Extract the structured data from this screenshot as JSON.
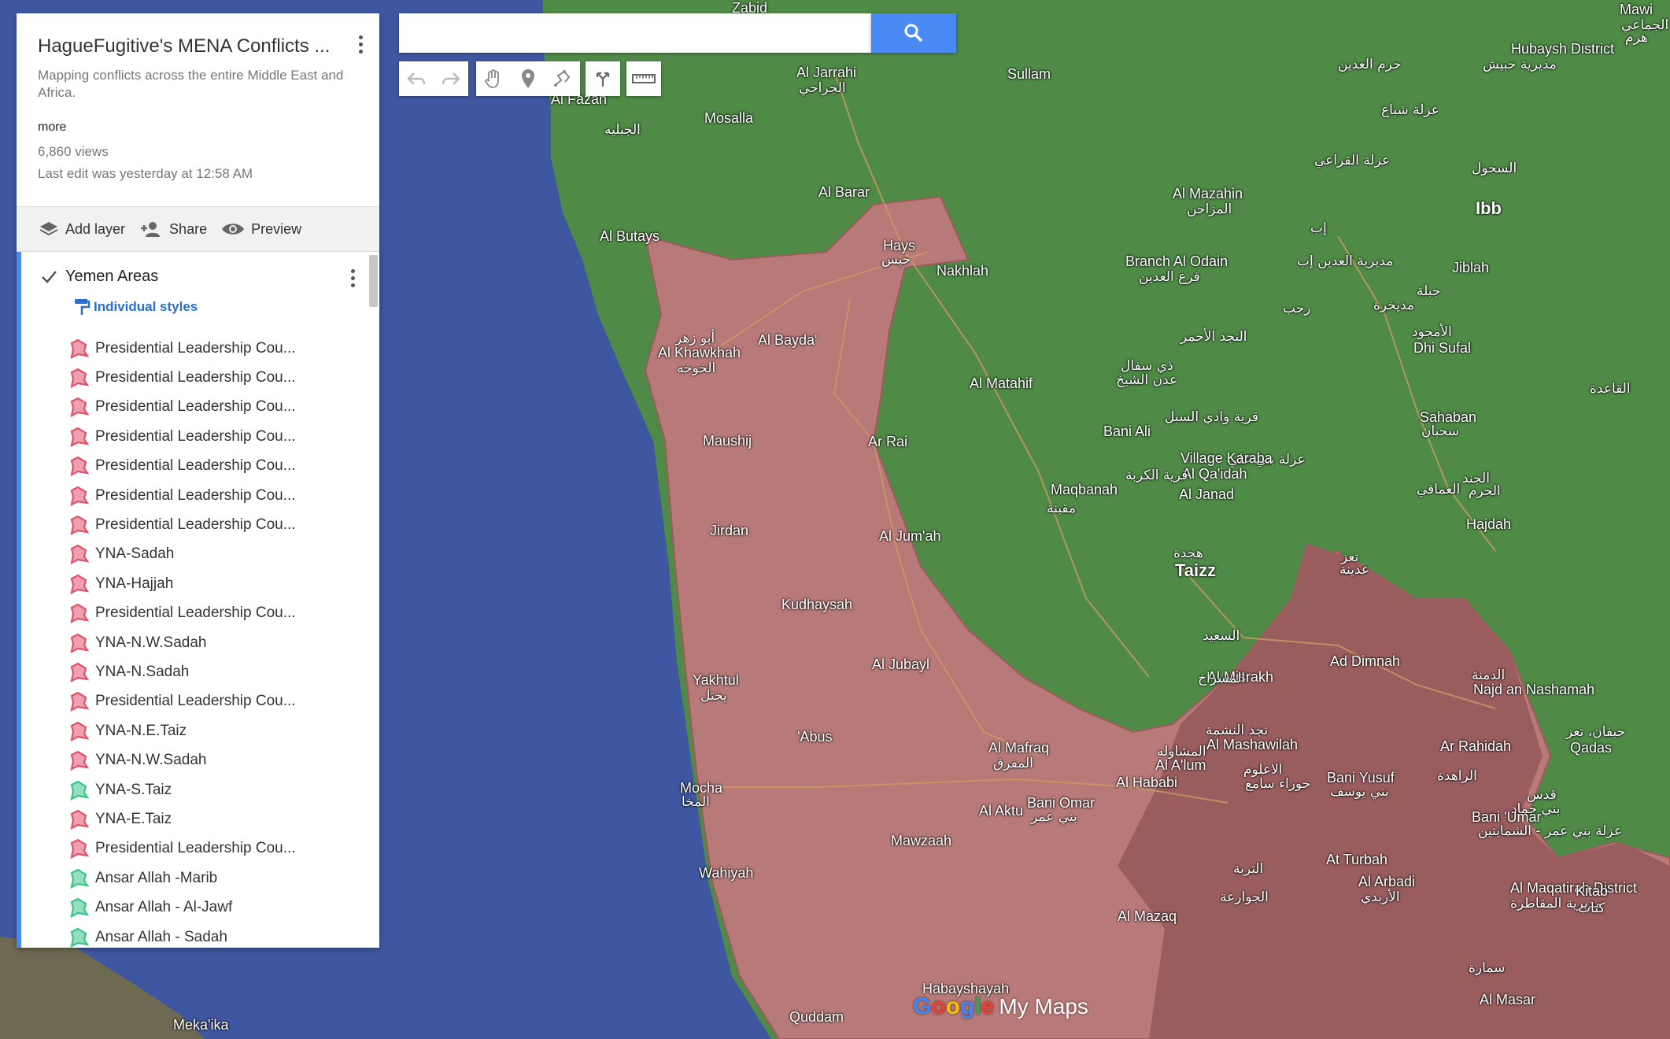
{
  "map": {
    "colors": {
      "sea": "#3f57a0",
      "land": "#4f8a47",
      "red_zone": "#b87a78",
      "dark_red_zone": "#9a5d5e",
      "panel_accent": "#4a8af4"
    },
    "labels": [
      {
        "text": "Zabid",
        "kind": "place"
      },
      {
        "text": "Al Jarrahi",
        "kind": "place"
      },
      {
        "text": "الجراحي",
        "kind": "ar"
      },
      {
        "text": "Al Fazah",
        "kind": "place"
      },
      {
        "text": "Mosalla",
        "kind": "place"
      },
      {
        "text": "الجبليه",
        "kind": "ar"
      },
      {
        "text": "Sullam",
        "kind": "place"
      },
      {
        "text": "Al Barar",
        "kind": "place"
      },
      {
        "text": "Al Butays",
        "kind": "place"
      },
      {
        "text": "Hays",
        "kind": "place"
      },
      {
        "text": "حيس",
        "kind": "ar"
      },
      {
        "text": "Nakhlah",
        "kind": "place"
      },
      {
        "text": "أبو زهر",
        "kind": "ar"
      },
      {
        "text": "Al Khawkhah",
        "kind": "place"
      },
      {
        "text": "الخوخه",
        "kind": "ar"
      },
      {
        "text": "Al Bayda'",
        "kind": "place"
      },
      {
        "text": "Al Matahif",
        "kind": "place"
      },
      {
        "text": "Maushij",
        "kind": "place"
      },
      {
        "text": "Ar Rai",
        "kind": "place"
      },
      {
        "text": "Jirdan",
        "kind": "place"
      },
      {
        "text": "Al Jum'ah",
        "kind": "place"
      },
      {
        "text": "Kudhaysah",
        "kind": "place"
      },
      {
        "text": "Al Jubayl",
        "kind": "place"
      },
      {
        "text": "Yakhtul",
        "kind": "place"
      },
      {
        "text": "يختل",
        "kind": "ar"
      },
      {
        "text": "'Abus",
        "kind": "place"
      },
      {
        "text": "Mocha",
        "kind": "place"
      },
      {
        "text": "المخا",
        "kind": "ar"
      },
      {
        "text": "Al Mafraq",
        "kind": "place"
      },
      {
        "text": "المفرق",
        "kind": "ar"
      },
      {
        "text": "Al Aktu",
        "kind": "place"
      },
      {
        "text": "Bani Omar",
        "kind": "place"
      },
      {
        "text": "بني عمر",
        "kind": "ar"
      },
      {
        "text": "Al Hababi",
        "kind": "place"
      },
      {
        "text": "Mawzaah",
        "kind": "place"
      },
      {
        "text": "Wahiyah",
        "kind": "place"
      },
      {
        "text": "Al Mazaq",
        "kind": "place"
      },
      {
        "text": "Habayshayah",
        "kind": "place"
      },
      {
        "text": "Quddam",
        "kind": "place"
      },
      {
        "text": "Meka'ika",
        "kind": "place"
      },
      {
        "text": "Hubaysh District",
        "kind": "place"
      },
      {
        "text": "مديرية حبيش",
        "kind": "ar"
      },
      {
        "text": "حرم العدين",
        "kind": "ar"
      },
      {
        "text": "عزلة شباع",
        "kind": "ar"
      },
      {
        "text": "عزلة القراعي",
        "kind": "ar"
      },
      {
        "text": "السحول",
        "kind": "ar"
      },
      {
        "text": "Al Mazahin",
        "kind": "place"
      },
      {
        "text": "المزاحن",
        "kind": "ar"
      },
      {
        "text": "Ibb",
        "kind": "city"
      },
      {
        "text": "إب",
        "kind": "ar"
      },
      {
        "text": "مديرية العدين إب",
        "kind": "ar"
      },
      {
        "text": "Branch Al Odain",
        "kind": "place"
      },
      {
        "text": "فرع العدين",
        "kind": "ar"
      },
      {
        "text": "Jiblah",
        "kind": "place"
      },
      {
        "text": "جبلة",
        "kind": "ar"
      },
      {
        "text": "رحب",
        "kind": "ar"
      },
      {
        "text": "مذيخرة",
        "kind": "ar"
      },
      {
        "text": "النجد الأحمر",
        "kind": "ar"
      },
      {
        "text": "الأمجود",
        "kind": "ar"
      },
      {
        "text": "Dhi Sufal",
        "kind": "place"
      },
      {
        "text": "ذي سفال",
        "kind": "ar"
      },
      {
        "text": "عدن الشيخ",
        "kind": "ar"
      },
      {
        "text": "قرية وادي السبل",
        "kind": "ar"
      },
      {
        "text": "Bani Ali",
        "kind": "place"
      },
      {
        "text": "عزلة بني علي",
        "kind": "ar"
      },
      {
        "text": "Al Qa'idah",
        "kind": "place"
      },
      {
        "text": "القاعدة",
        "kind": "ar"
      },
      {
        "text": "Sahaban",
        "kind": "place"
      },
      {
        "text": "سحبان",
        "kind": "ar"
      },
      {
        "text": "Village Karaba",
        "kind": "place"
      },
      {
        "text": "قرية الكربة",
        "kind": "ar"
      },
      {
        "text": "العماقي",
        "kind": "ar"
      },
      {
        "text": "Maqbanah",
        "kind": "place"
      },
      {
        "text": "مقبنة",
        "kind": "ar"
      },
      {
        "text": "Al Janad",
        "kind": "place"
      },
      {
        "text": "الجند",
        "kind": "ar"
      },
      {
        "text": "الجرم",
        "kind": "ar"
      },
      {
        "text": "Hajdah",
        "kind": "place"
      },
      {
        "text": "هجدة",
        "kind": "ar"
      },
      {
        "text": "Taizz",
        "kind": "city"
      },
      {
        "text": "تعز",
        "kind": "ar"
      },
      {
        "text": "عدينة",
        "kind": "ar"
      },
      {
        "text": "السعيد",
        "kind": "ar"
      },
      {
        "text": "Al Misrakh",
        "kind": "place"
      },
      {
        "text": "المسراخ",
        "kind": "ar"
      },
      {
        "text": "Ad Dimnah",
        "kind": "place"
      },
      {
        "text": "الدمنة",
        "kind": "ar"
      },
      {
        "text": "Najd an Nashamah",
        "kind": "place"
      },
      {
        "text": "نجد النشمة",
        "kind": "ar"
      },
      {
        "text": "Al Mashawilah",
        "kind": "place"
      },
      {
        "text": "المشاوله",
        "kind": "ar"
      },
      {
        "text": "Al A'lum",
        "kind": "place"
      },
      {
        "text": "الاعلوم",
        "kind": "ar"
      },
      {
        "text": "خوراء سامع",
        "kind": "ar"
      },
      {
        "text": "Bani Yusuf",
        "kind": "place"
      },
      {
        "text": "بني يوسف",
        "kind": "ar"
      },
      {
        "text": "Ar Rahidah",
        "kind": "place"
      },
      {
        "text": "الراهدة",
        "kind": "ar"
      },
      {
        "text": "حيفان، تعز",
        "kind": "ar"
      },
      {
        "text": "Qadas",
        "kind": "place"
      },
      {
        "text": "قدس",
        "kind": "ar"
      },
      {
        "text": "بني حماد",
        "kind": "ar"
      },
      {
        "text": "Bani 'Umar",
        "kind": "place"
      },
      {
        "text": "عزلة بني عمر - الشمايتين",
        "kind": "ar"
      },
      {
        "text": "At Turbah",
        "kind": "place"
      },
      {
        "text": "التربة",
        "kind": "ar"
      },
      {
        "text": "الجوارعة",
        "kind": "ar"
      },
      {
        "text": "Al Arbadi",
        "kind": "place"
      },
      {
        "text": "الأربدي",
        "kind": "ar"
      },
      {
        "text": "Al Maqatirah District",
        "kind": "place"
      },
      {
        "text": "مديرية المقاطرة",
        "kind": "ar"
      },
      {
        "text": "Kitab",
        "kind": "place"
      },
      {
        "text": "كتاب",
        "kind": "ar"
      },
      {
        "text": "سمارة",
        "kind": "ar"
      },
      {
        "text": "Al Masar",
        "kind": "place"
      },
      {
        "text": "Mawi",
        "kind": "place"
      },
      {
        "text": "نجد الجماعي",
        "kind": "ar"
      },
      {
        "text": "هرم",
        "kind": "ar"
      }
    ],
    "branding": {
      "google": "Google",
      "mymaps": "My Maps"
    }
  },
  "panel": {
    "title": "HagueFugitive's MENA Conflicts ...",
    "description": "Mapping conflicts across the entire Middle East and Africa.",
    "more_label": "more",
    "views": "6,860 views",
    "last_edit": "Last edit was yesterday at 12:58 AM",
    "toolbar": {
      "add_layer": "Add layer",
      "share": "Share",
      "preview": "Preview"
    },
    "layer": {
      "name": "Yemen Areas",
      "styles_label": "Individual styles",
      "items": [
        {
          "label": "Presidential Leadership Cou...",
          "color": "#e0526a"
        },
        {
          "label": "Presidential Leadership Cou...",
          "color": "#e0526a"
        },
        {
          "label": "Presidential Leadership Cou...",
          "color": "#e0526a"
        },
        {
          "label": "Presidential Leadership Cou...",
          "color": "#e0526a"
        },
        {
          "label": "Presidential Leadership Cou...",
          "color": "#e0526a"
        },
        {
          "label": "Presidential Leadership Cou...",
          "color": "#e0526a"
        },
        {
          "label": "Presidential Leadership Cou...",
          "color": "#e0526a"
        },
        {
          "label": "YNA-Sadah",
          "color": "#e0526a"
        },
        {
          "label": "YNA-Hajjah",
          "color": "#e0526a"
        },
        {
          "label": "Presidential Leadership Cou...",
          "color": "#e0526a"
        },
        {
          "label": "YNA-N.W.Sadah",
          "color": "#e0526a"
        },
        {
          "label": "YNA-N.Sadah",
          "color": "#e0526a"
        },
        {
          "label": "Presidential Leadership Cou...",
          "color": "#e0526a"
        },
        {
          "label": "YNA-N.E.Taiz",
          "color": "#e0526a"
        },
        {
          "label": "YNA-N.W.Sadah",
          "color": "#e0526a"
        },
        {
          "label": "YNA-S.Taiz",
          "color": "#3bc48a"
        },
        {
          "label": "YNA-E.Taiz",
          "color": "#e0526a"
        },
        {
          "label": "Presidential Leadership Cou...",
          "color": "#e0526a"
        },
        {
          "label": "Ansar Allah -Marib",
          "color": "#3bc48a"
        },
        {
          "label": "Ansar Allah - Al-Jawf",
          "color": "#3bc48a"
        },
        {
          "label": "Ansar Allah - Sadah",
          "color": "#3bc48a"
        }
      ]
    }
  },
  "search": {
    "value": "",
    "placeholder": ""
  },
  "tools": [
    "undo-icon",
    "redo-icon",
    "hand-icon",
    "marker-icon",
    "draw-line-icon",
    "directions-icon",
    "ruler-icon"
  ]
}
